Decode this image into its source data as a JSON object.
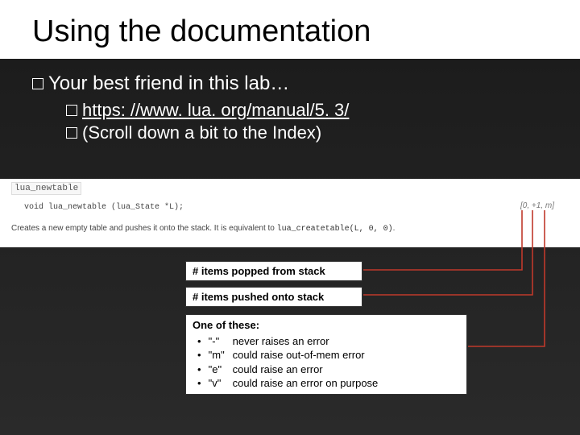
{
  "title": "Using the documentation",
  "main_bullet": "Your best friend in this lab…",
  "sub1": "https: //www. lua. org/manual/5. 3/",
  "sub2": "(Scroll down a bit to the Index)",
  "doc": {
    "fn": "lua_newtable",
    "sig": "void lua_newtable (lua_State *L);",
    "desc_pre": "Creates a new empty table and pushes it onto the stack. It is equivalent to ",
    "desc_code": "lua_createtable(L, 0, 0)",
    "desc_post": ".",
    "bracket": {
      "a": "[0,",
      "b": "+1,",
      "c": "m]"
    }
  },
  "callouts": {
    "popped": "# items popped from stack",
    "pushed": "# items pushed onto stack",
    "legend_hd": "One of these:",
    "legend": [
      {
        "sym": "\"-\"",
        "txt": "never raises an error"
      },
      {
        "sym": "\"m\"",
        "txt": "could raise out-of-mem error"
      },
      {
        "sym": "\"e\"",
        "txt": "could raise an error"
      },
      {
        "sym": "\"v\"",
        "txt": "could raise an error on purpose"
      }
    ]
  }
}
